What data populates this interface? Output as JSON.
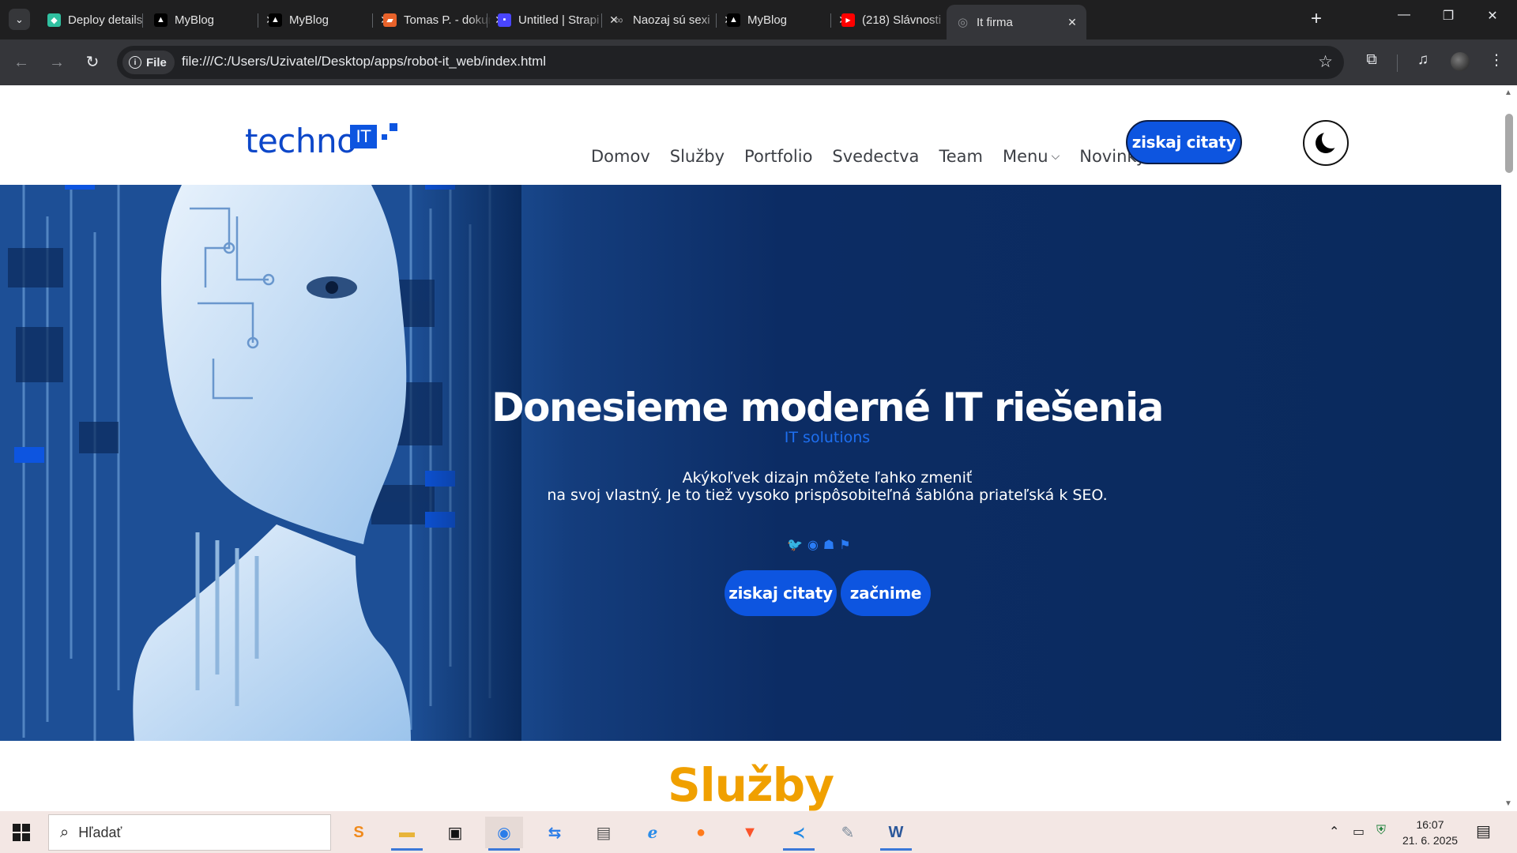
{
  "browser": {
    "tabs": [
      {
        "title": "Deploy details",
        "icon": "deploy-icon",
        "color": "#30c0a0"
      },
      {
        "title": "MyBlog",
        "icon": "myblog-icon",
        "color": "#000000"
      },
      {
        "title": "MyBlog",
        "icon": "myblog-icon",
        "color": "#000000"
      },
      {
        "title": "Tomas P. - dokumenty",
        "icon": "folder-icon",
        "color": "#e8622a"
      },
      {
        "title": "Untitled | Strapi",
        "icon": "strapi-icon",
        "color": "#4945ff"
      },
      {
        "title": "Naozaj sú sexi",
        "icon": "infinity-icon",
        "color": "#555555"
      },
      {
        "title": "MyBlog",
        "icon": "myblog-icon",
        "color": "#000000"
      },
      {
        "title": "(218) Slávnosti",
        "icon": "youtube-icon",
        "color": "#ff0000"
      },
      {
        "title": "It firma",
        "icon": "globe-icon",
        "color": "#8a8c90"
      }
    ],
    "close_glyph": "✕",
    "new_tab": "+",
    "chip_label": "File",
    "url": "file:///C:/Users/Uzivatel/Desktop/apps/robot-it_web/index.html"
  },
  "site": {
    "logo_text": "techno",
    "logo_badge": "IT",
    "nav": [
      "Domov",
      "Služby",
      "Portfolio",
      "Svedectva",
      "Team",
      "Menu",
      "Novinky"
    ],
    "header_cta": "ziskaj citaty",
    "hero": {
      "title": "Donesieme moderné IT riešenia",
      "subtitle": "IT solutions",
      "desc_line1": "Akýkoľvek dizajn môžete ľahko zmeniť",
      "desc_line2": "na svoj vlastný. Je to tiež vysoko prispôsobiteľná šablóna priateľská k SEO.",
      "btn_primary": "ziskaj citaty",
      "btn_secondary": "začnime",
      "socials": [
        "twitter-icon",
        "messenger-icon",
        "snapchat-icon",
        "playstation-icon"
      ]
    },
    "services_title": "Služby",
    "colors": {
      "accent": "#0d55e0",
      "hero_bg": "#0a2a5c",
      "services": "#f0a000"
    }
  },
  "taskbar": {
    "search_placeholder": "Hľadať",
    "time": "16:07",
    "date": "21. 6. 2025"
  }
}
